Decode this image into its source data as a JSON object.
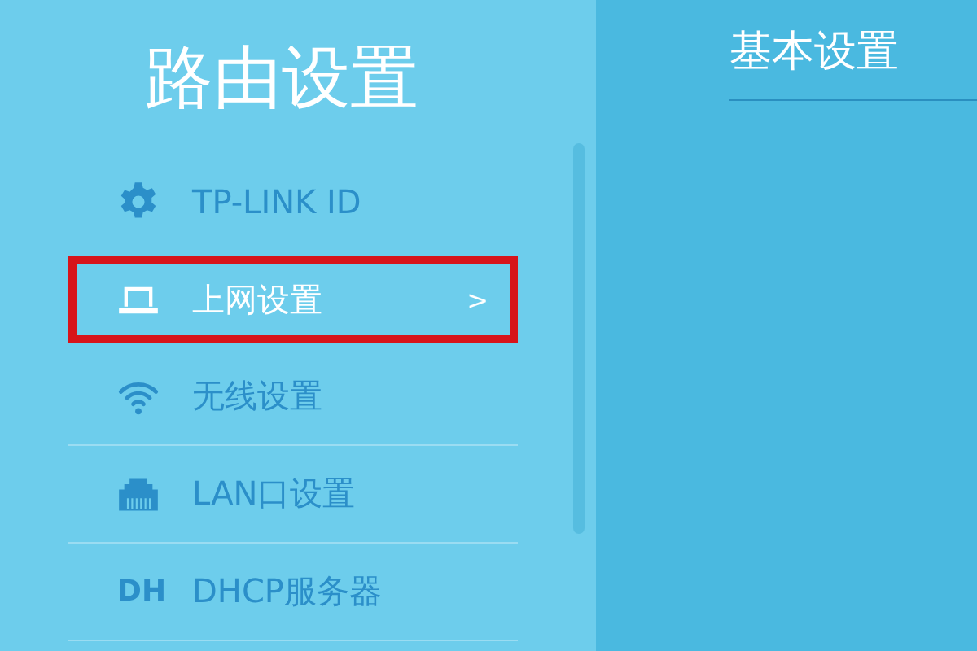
{
  "sidebar": {
    "title": "路由设置",
    "items": [
      {
        "kind": "gear",
        "label": "TP-LINK ID",
        "selected": false
      },
      {
        "kind": "laptop",
        "label": "上网设置",
        "selected": true,
        "arrow": ">"
      },
      {
        "kind": "wifi",
        "label": "无线设置",
        "selected": false
      },
      {
        "kind": "lan",
        "label": "LAN口设置",
        "selected": false
      },
      {
        "kind": "text",
        "icon_text": "DH",
        "label": "DHCP服务器",
        "selected": false
      }
    ]
  },
  "main": {
    "heading": "基本设置"
  }
}
